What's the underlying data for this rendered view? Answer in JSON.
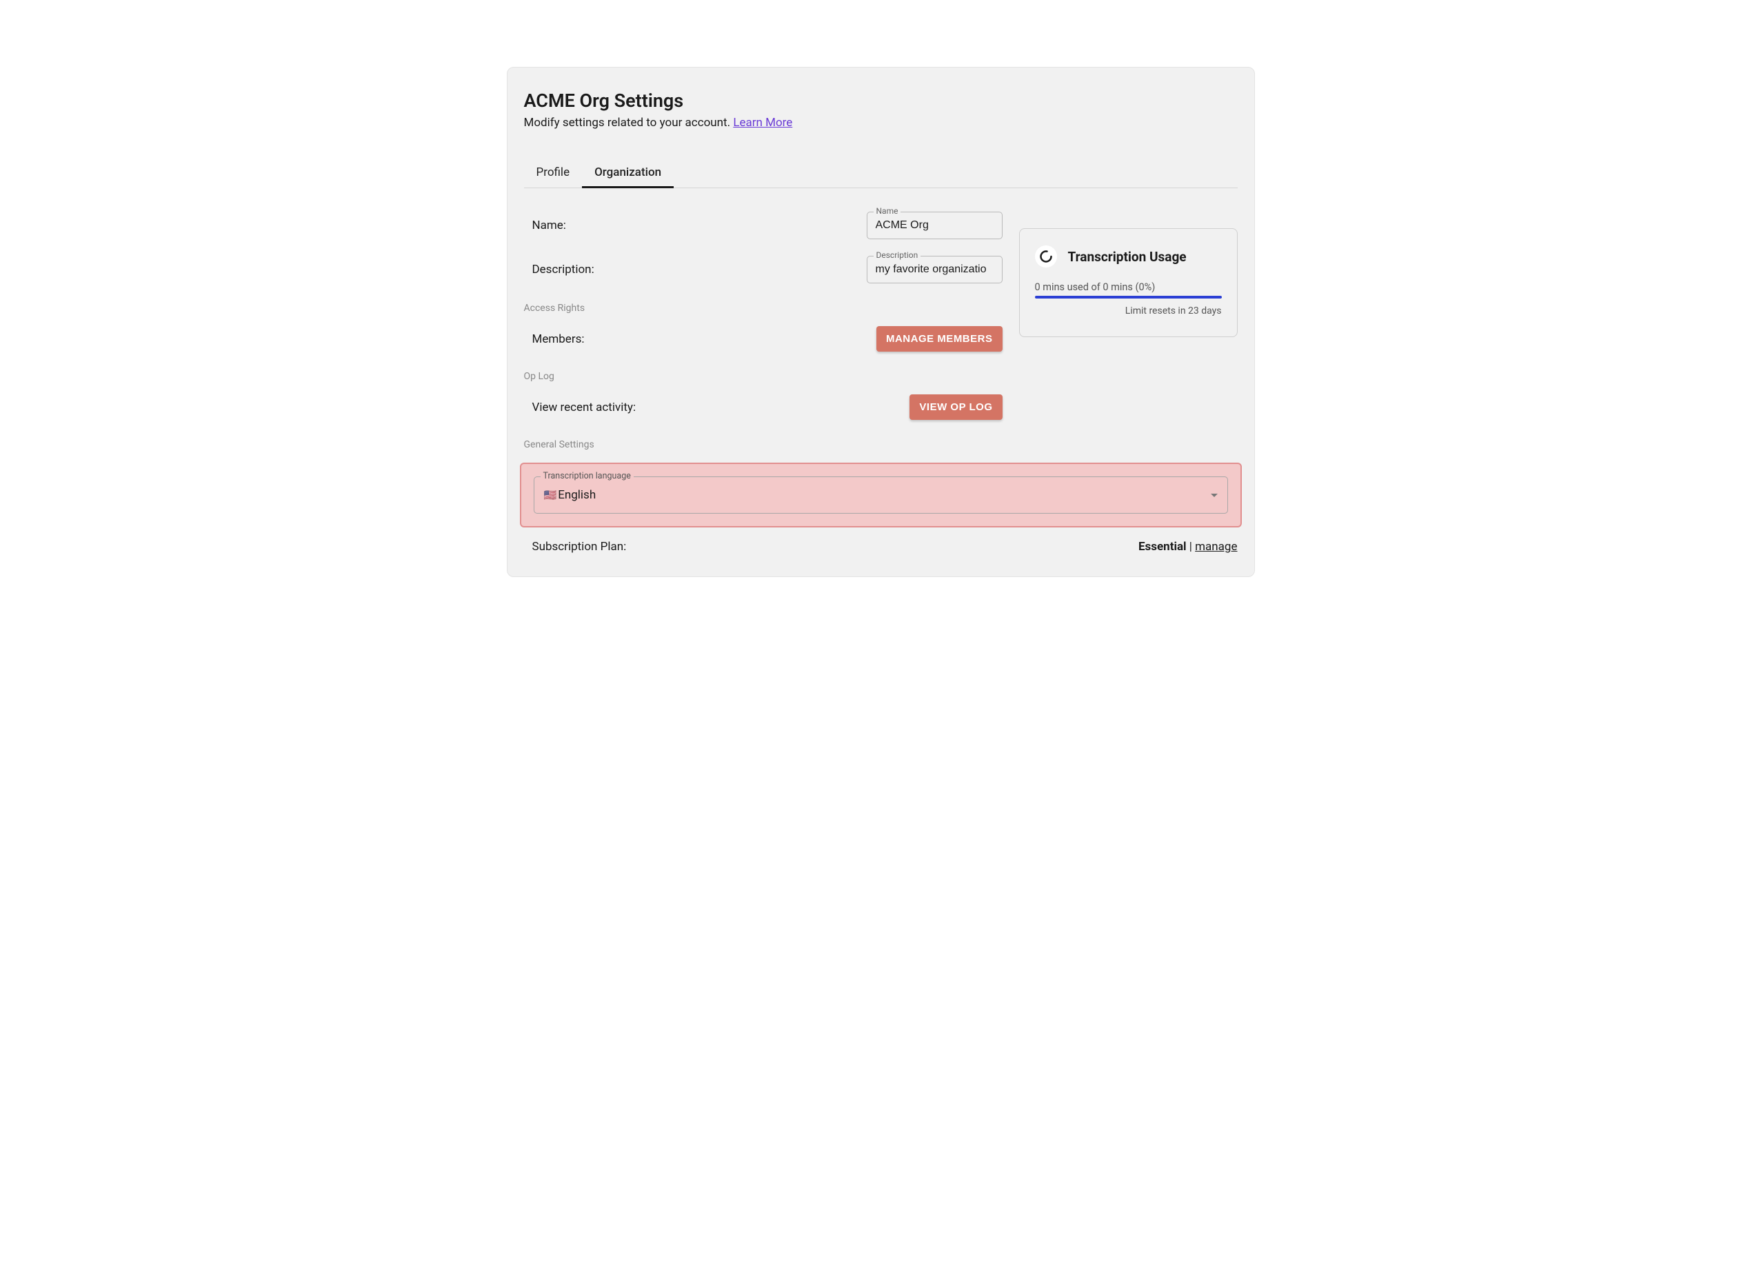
{
  "header": {
    "title": "ACME Org Settings",
    "subtitle_prefix": "Modify settings related to your account. ",
    "learn_more": "Learn More"
  },
  "tabs": {
    "profile": "Profile",
    "organization": "Organization"
  },
  "form": {
    "name_label": "Name:",
    "name_field_label": "Name",
    "name_value": "ACME Org",
    "desc_label": "Description:",
    "desc_field_label": "Description",
    "desc_value": "my favorite organizatio"
  },
  "sections": {
    "access_rights": "Access Rights",
    "op_log": "Op Log",
    "general_settings": "General Settings"
  },
  "members": {
    "label": "Members:",
    "button": "MANAGE MEMBERS"
  },
  "oplog": {
    "label": "View recent activity:",
    "button": "VIEW OP LOG"
  },
  "language": {
    "field_label": "Transcription language",
    "flag": "🇺🇸",
    "value": "English"
  },
  "plan": {
    "label": "Subscription Plan:",
    "name": "Essential",
    "separator": " |  ",
    "manage": "manage"
  },
  "usage": {
    "title": "Transcription Usage",
    "line": "0 mins used of 0 mins (0%)",
    "reset": "Limit resets in 23 days"
  }
}
